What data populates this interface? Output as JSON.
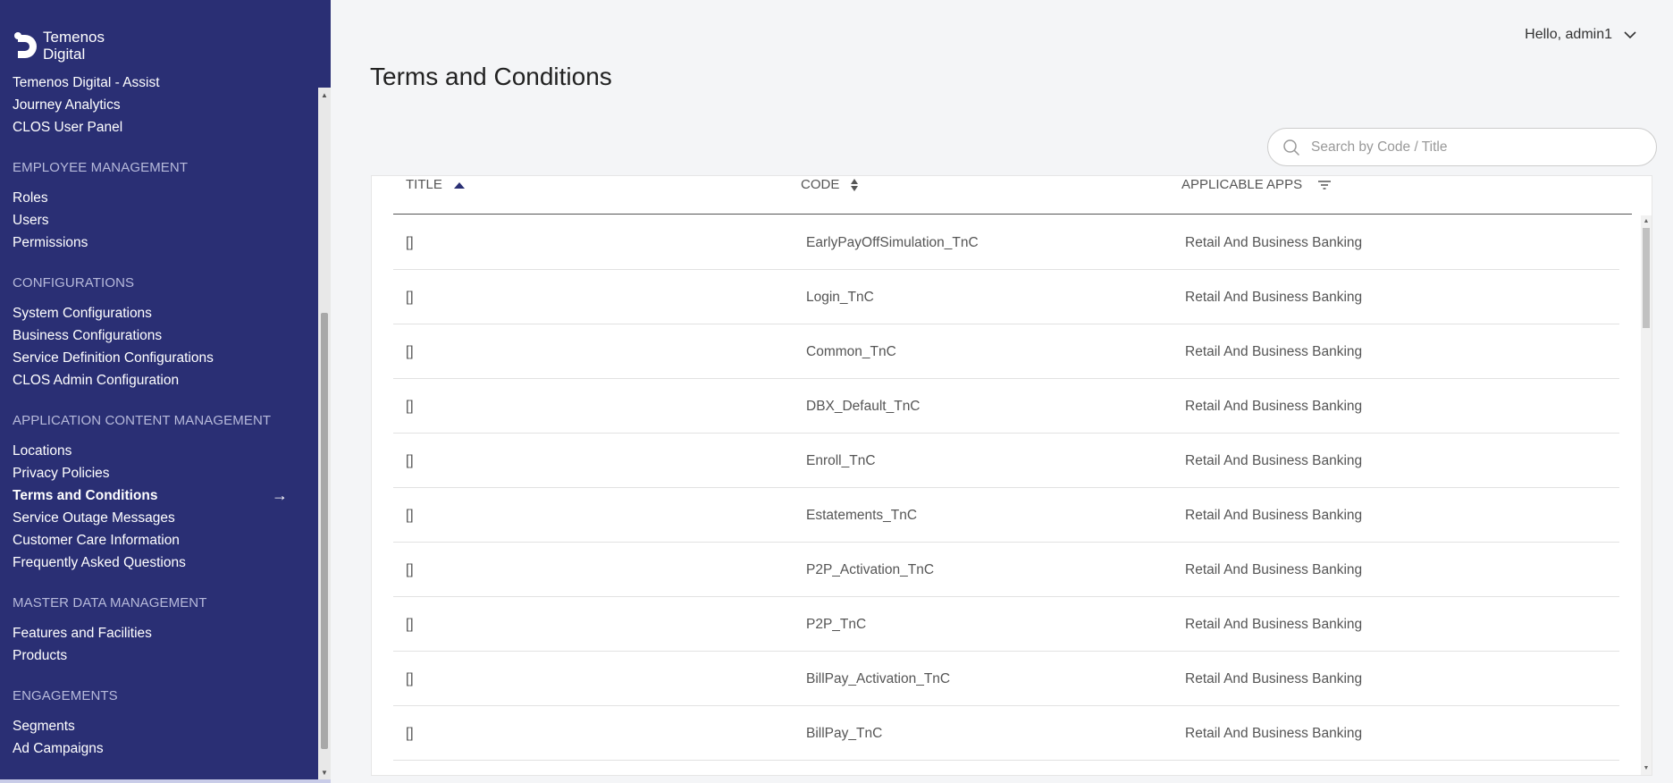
{
  "brand": {
    "line1": "Temenos",
    "line2": "Digital"
  },
  "sidebar": {
    "top_items": [
      {
        "label": "Temenos Digital - Assist"
      },
      {
        "label": "Journey Analytics"
      },
      {
        "label": "CLOS User Panel"
      }
    ],
    "sections": [
      {
        "header": "EMPLOYEE MANAGEMENT",
        "items": [
          "Roles",
          "Users",
          "Permissions"
        ]
      },
      {
        "header": "CONFIGURATIONS",
        "items": [
          "System Configurations",
          "Business Configurations",
          "Service Definition Configurations",
          "CLOS Admin Configuration"
        ]
      },
      {
        "header": "APPLICATION CONTENT MANAGEMENT",
        "items": [
          "Locations",
          "Privacy Policies",
          "Terms and Conditions",
          "Service Outage Messages",
          "Customer Care Information",
          "Frequently Asked Questions"
        ]
      },
      {
        "header": "MASTER DATA MANAGEMENT",
        "items": [
          "Features and Facilities",
          "Products"
        ]
      },
      {
        "header": "ENGAGEMENTS",
        "items": [
          "Segments",
          "Ad Campaigns"
        ]
      }
    ],
    "active_item": "Terms and Conditions"
  },
  "header": {
    "greeting": "Hello, admin1"
  },
  "page": {
    "title": "Terms and Conditions"
  },
  "search": {
    "placeholder": "Search by Code / Title",
    "value": ""
  },
  "table": {
    "columns": {
      "title": "TITLE",
      "code": "CODE",
      "apps": "APPLICABLE APPS"
    },
    "rows": [
      {
        "title": "[]",
        "code": "EarlyPayOffSimulation_TnC",
        "apps": "Retail And Business Banking"
      },
      {
        "title": "[]",
        "code": "Login_TnC",
        "apps": "Retail And Business Banking"
      },
      {
        "title": "[]",
        "code": "Common_TnC",
        "apps": "Retail And Business Banking"
      },
      {
        "title": "[]",
        "code": "DBX_Default_TnC",
        "apps": "Retail And Business Banking"
      },
      {
        "title": "[]",
        "code": "Enroll_TnC",
        "apps": "Retail And Business Banking"
      },
      {
        "title": "[]",
        "code": "Estatements_TnC",
        "apps": "Retail And Business Banking"
      },
      {
        "title": "[]",
        "code": "P2P_Activation_TnC",
        "apps": "Retail And Business Banking"
      },
      {
        "title": "[]",
        "code": "P2P_TnC",
        "apps": "Retail And Business Banking"
      },
      {
        "title": "[]",
        "code": "BillPay_Activation_TnC",
        "apps": "Retail And Business Banking"
      },
      {
        "title": "[]",
        "code": "BillPay_TnC",
        "apps": "Retail And Business Banking"
      }
    ]
  },
  "icons": {
    "logo": "temenos-logo",
    "user_menu": "chevron-down-icon",
    "search": "search-icon",
    "sort_asc": "sort-ascending-icon",
    "sort_both": "sort-icon",
    "filter": "filter-icon",
    "active_arrow": "arrow-right-icon"
  },
  "colors": {
    "sidebar_bg": "#2a2f74",
    "page_bg": "#f4f5f7",
    "header_text": "#b7badb"
  }
}
